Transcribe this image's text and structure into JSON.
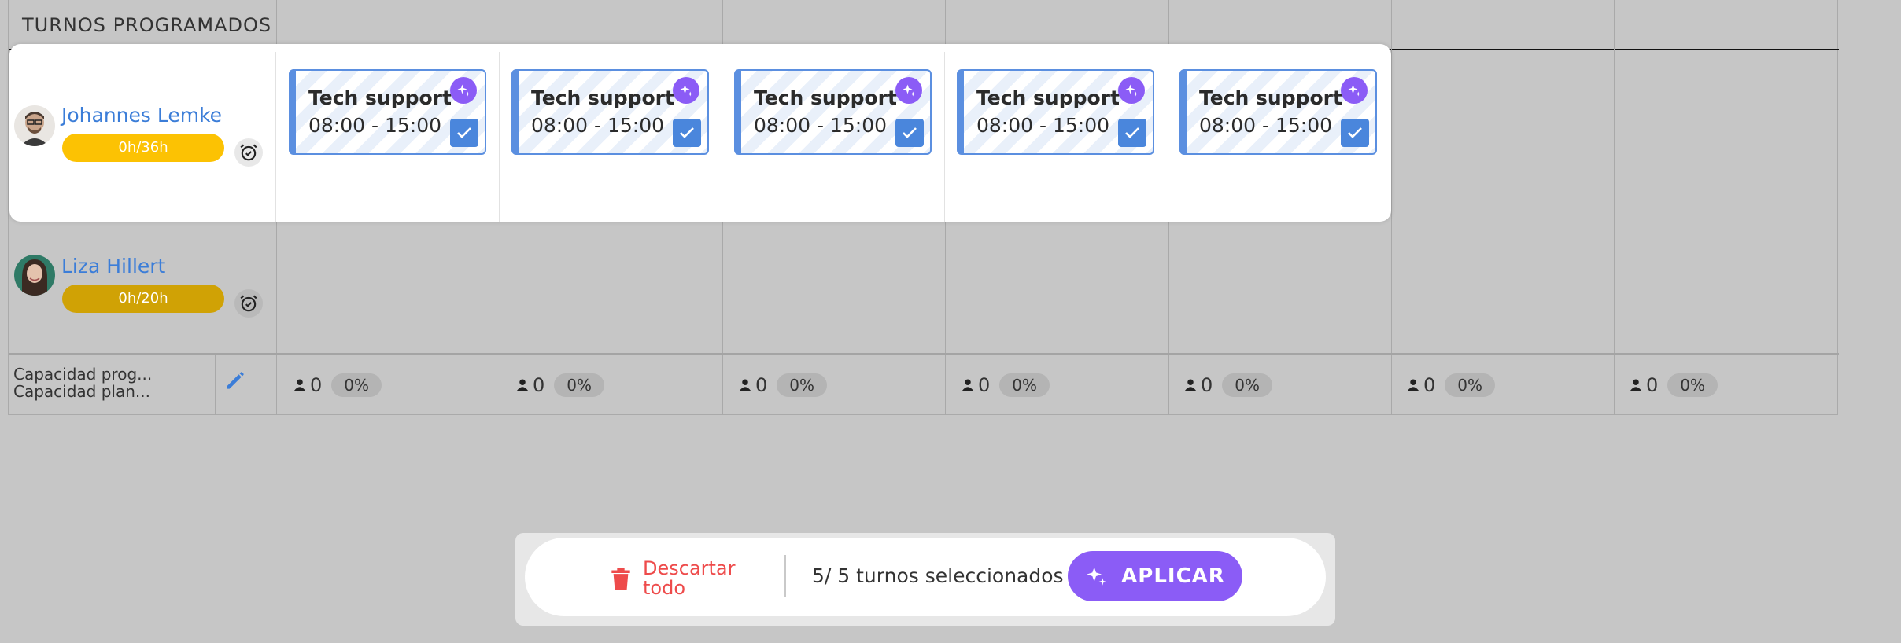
{
  "section": {
    "title": "TURNOS PROGRAMADOS"
  },
  "employees": [
    {
      "name": "Johannes Lemke",
      "hours": "0h/36h",
      "hours_color": "#fcc203"
    },
    {
      "name": "Liza Hillert",
      "hours": "0h/20h",
      "hours_color": "#d0a205"
    }
  ],
  "shifts": [
    {
      "title": "Tech support",
      "time": "08:00 - 15:00"
    },
    {
      "title": "Tech support",
      "time": "08:00 - 15:00"
    },
    {
      "title": "Tech support",
      "time": "08:00 - 15:00"
    },
    {
      "title": "Tech support",
      "time": "08:00 - 15:00"
    },
    {
      "title": "Tech support",
      "time": "08:00 - 15:00"
    }
  ],
  "capacity": {
    "labels": [
      "Capacidad prog...",
      "Capacidad plan..."
    ],
    "days": [
      {
        "count": "0",
        "percent": "0%"
      },
      {
        "count": "0",
        "percent": "0%"
      },
      {
        "count": "0",
        "percent": "0%"
      },
      {
        "count": "0",
        "percent": "0%"
      },
      {
        "count": "0",
        "percent": "0%"
      },
      {
        "count": "0",
        "percent": "0%"
      },
      {
        "count": "0",
        "percent": "0%"
      }
    ]
  },
  "action_bar": {
    "discard_label": "Descartar todo",
    "selected_text": "5/ 5 turnos seleccionados",
    "apply_label": "APLICAR"
  },
  "colors": {
    "accent_purple": "#8b5cf6",
    "accent_blue": "#4a86dc",
    "danger": "#ee4b4b"
  },
  "icons": [
    "alarm-clock-icon",
    "sparkle-icon",
    "checkmark-icon",
    "person-icon",
    "pencil-icon",
    "trash-icon"
  ]
}
